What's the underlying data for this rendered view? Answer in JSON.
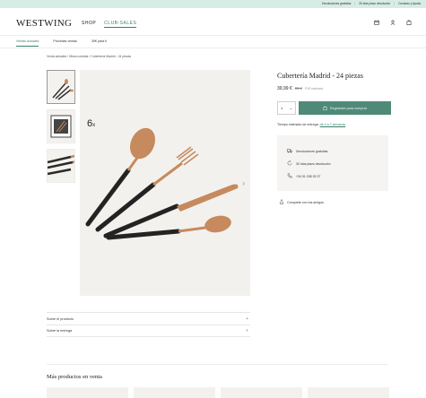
{
  "topbar": {
    "link1": "Devoluciones gratuitas",
    "link2": "30 días plazo devolución",
    "link3": "Contacto y Ayuda"
  },
  "header": {
    "logo": "WESTWING",
    "nav_shop": "SHOP",
    "nav_club": "CLUB-SALES",
    "icons": [
      "calendar-icon",
      "user-icon",
      "bag-icon"
    ]
  },
  "subnav": {
    "items": [
      "Ventas actuales",
      "Próximas ventas",
      "30€ para ti"
    ]
  },
  "breadcrumb": {
    "items": [
      "Venta actuales",
      "Mesa colorida",
      "Cubertería Madrid - 24 piezas"
    ],
    "separator": "/"
  },
  "product": {
    "title": "Cubertería Madrid - 24 piezas",
    "price": "39,99 €",
    "old_price": "83 €",
    "pvr_label": "PVR estimado",
    "quantity": "1",
    "register_button": "Regístrate para comprar",
    "delivery_prefix": "Tiempo estimado de entrega:",
    "delivery_value": "de 4 a 7 semanas",
    "image_quantity": "6",
    "image_quantity_suffix": "x"
  },
  "info": {
    "returns": "Devoluciones gratuitas",
    "days": "30 días plazo devolución",
    "phone": "+34 91 208 29 37"
  },
  "share_label": "Comparte con tus amigos",
  "accordion": {
    "about": "Sobre el producto",
    "delivery": "Sobre la entrega"
  },
  "more": {
    "title": "Más productos en venta"
  },
  "colors": {
    "accent": "#3a7f6c",
    "button": "#4f8a79",
    "topbar": "#d6ece5",
    "copper": "#c68a5e"
  }
}
